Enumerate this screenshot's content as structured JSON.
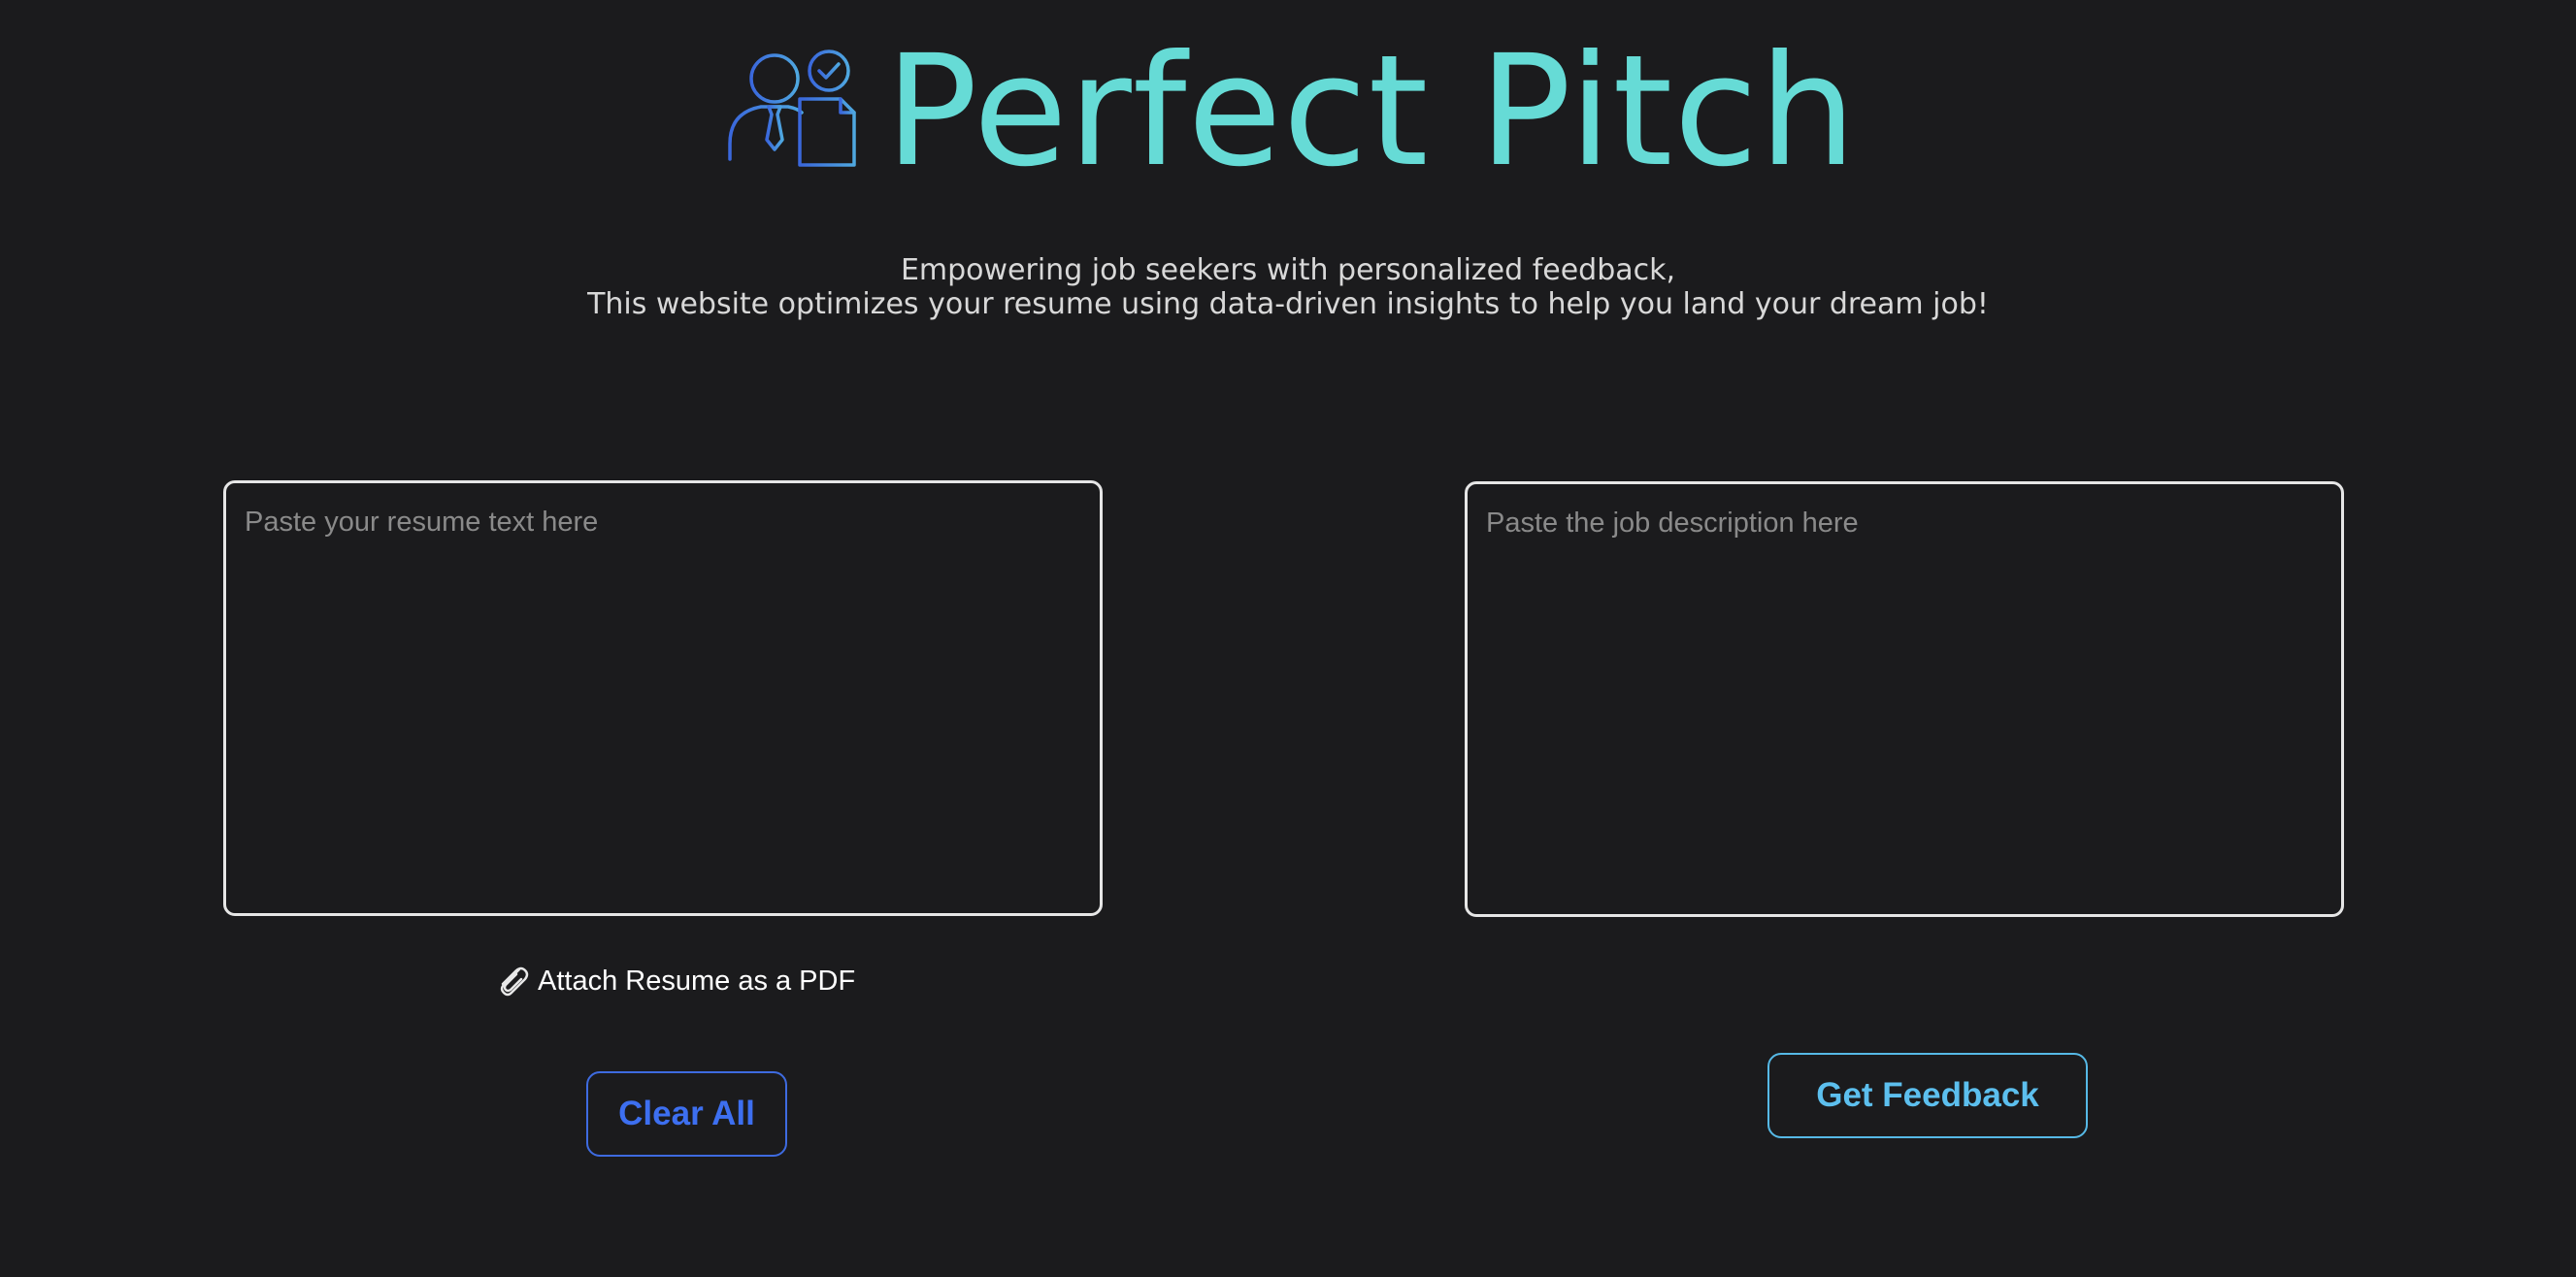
{
  "header": {
    "title": "Perfect Pitch",
    "logo_icon": "person-resume-check-icon",
    "tagline_line1": "Empowering job seekers with personalized feedback,",
    "tagline_line2": "This website optimizes your resume using data-driven insights to help you land your dream job!"
  },
  "resume_input": {
    "placeholder": "Paste your resume text here",
    "value": ""
  },
  "job_input": {
    "placeholder": "Paste the job description here",
    "value": ""
  },
  "attach": {
    "icon": "paperclip-icon",
    "label": "Attach Resume as a PDF"
  },
  "buttons": {
    "clear_label": "Clear All",
    "feedback_label": "Get Feedback"
  },
  "colors": {
    "background": "#1b1b1d",
    "title": "#66dbd6",
    "clear_button": "#3d6ff0",
    "feedback_button": "#5cbfee"
  }
}
